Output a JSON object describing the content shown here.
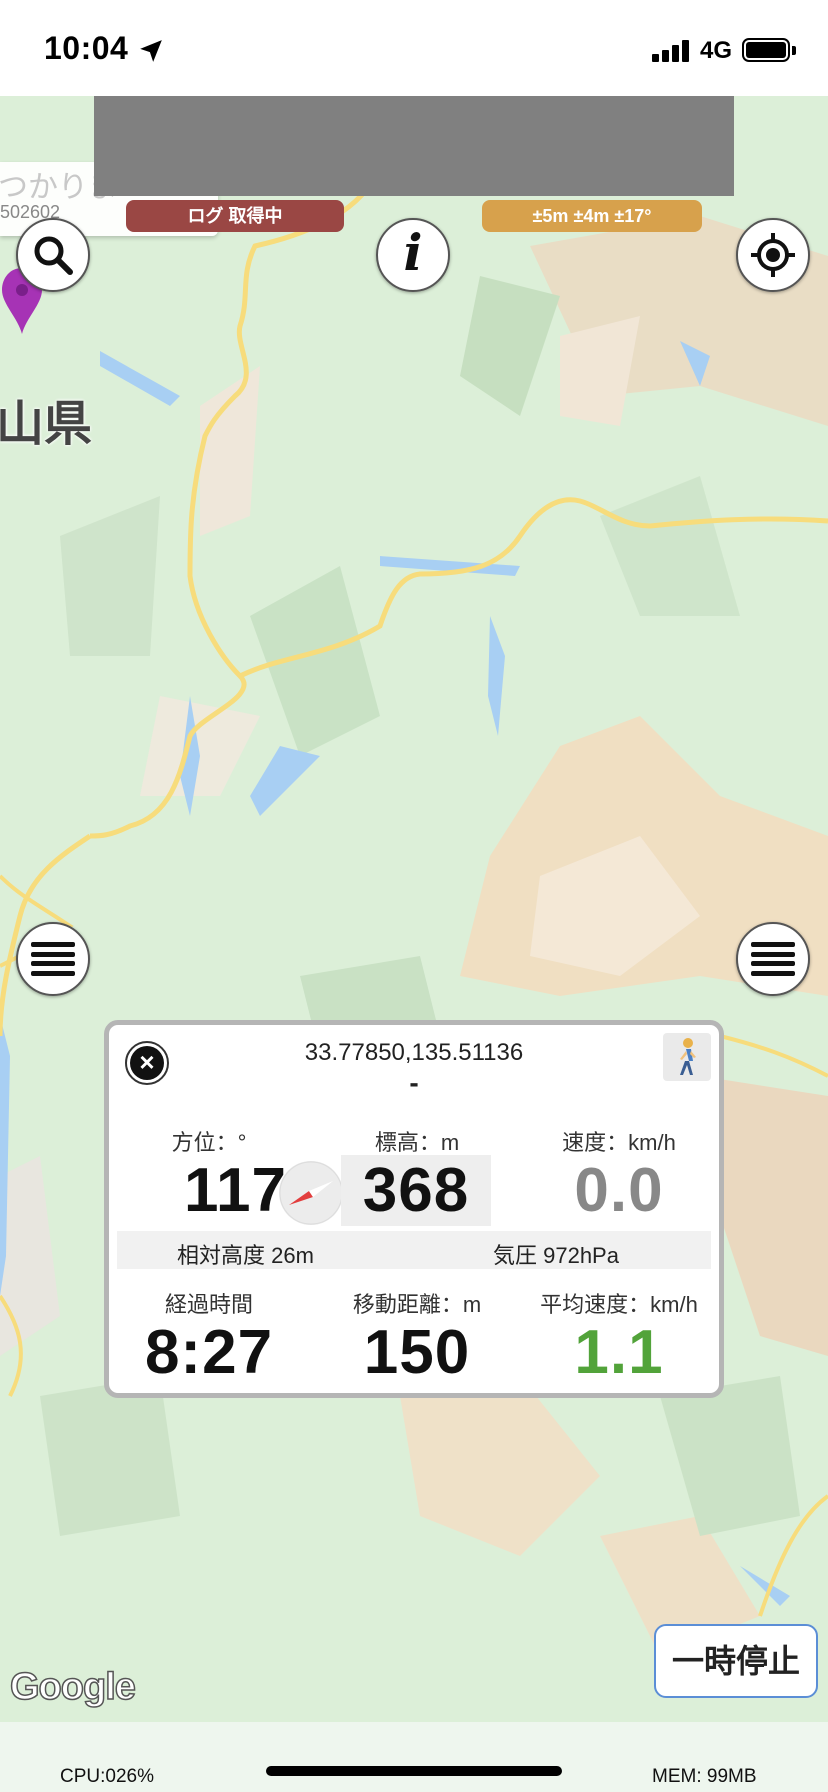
{
  "status_bar": {
    "time": "10:04",
    "network": "4G"
  },
  "map": {
    "previous_search_text": "つかりま",
    "previous_search_code": "502602",
    "prefecture_label": "山県",
    "log_status": "ログ 取得中",
    "accuracy": "±5m ±4m ±17°",
    "attribution": "Google",
    "pause_button": "一時停止"
  },
  "panel": {
    "coordinates": "33.77850,135.51136",
    "place_name": "-",
    "heading": {
      "label": "方位：°",
      "value": "117"
    },
    "elevation": {
      "label": "標高：m",
      "value": "368"
    },
    "speed": {
      "label": "速度：km/h",
      "value": "0.0"
    },
    "relative_altitude": "相対高度 26m",
    "pressure": "気圧 972hPa",
    "elapsed": {
      "label": "経過時間",
      "value": "8:27"
    },
    "distance": {
      "label": "移動距離：m",
      "value": "150"
    },
    "avg_speed": {
      "label": "平均速度：km/h",
      "value": "1.1"
    }
  },
  "footer": {
    "cpu": "CPU:026%",
    "mem": "MEM: 99MB"
  },
  "colors": {
    "log_pill": "#9a4744",
    "accuracy_pill": "#d7a14c",
    "avg_speed": "#52a33a",
    "pin": "#a633b5",
    "road": "#f7dc7c",
    "water": "#a8cff3"
  },
  "icons": [
    "location-arrow-icon",
    "signal-icon",
    "battery-icon",
    "search-icon",
    "info-icon",
    "locate-icon",
    "menu-icon",
    "map-pin-icon",
    "close-icon",
    "compass-icon",
    "walker-icon"
  ]
}
